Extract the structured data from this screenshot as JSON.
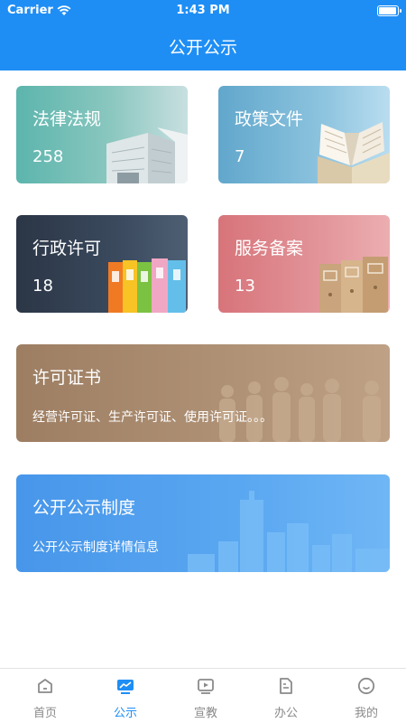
{
  "status_bar": {
    "carrier": "Carrier",
    "time": "1:43 PM"
  },
  "nav": {
    "title": "公开公示"
  },
  "cards": {
    "laws": {
      "title": "法律法规",
      "count": "258"
    },
    "policy": {
      "title": "政策文件",
      "count": "7"
    },
    "license": {
      "title": "行政许可",
      "count": "18"
    },
    "service": {
      "title": "服务备案",
      "count": "13"
    },
    "certificate": {
      "title": "许可证书",
      "subtitle": "经营许可证、生产许可证、使用许可证。。。"
    },
    "system": {
      "title": "公开公示制度",
      "subtitle": "公开公示制度详情信息"
    }
  },
  "tabbar": {
    "items": [
      {
        "label": "首页",
        "icon": "home-icon",
        "active": false
      },
      {
        "label": "公示",
        "icon": "chart-monitor-icon",
        "active": true
      },
      {
        "label": "宣教",
        "icon": "video-icon",
        "active": false
      },
      {
        "label": "办公",
        "icon": "document-icon",
        "active": false
      },
      {
        "label": "我的",
        "icon": "smile-face-icon",
        "active": false
      }
    ]
  },
  "colors": {
    "primary": "#1e8ef5",
    "inactive": "#8a8a8a"
  }
}
